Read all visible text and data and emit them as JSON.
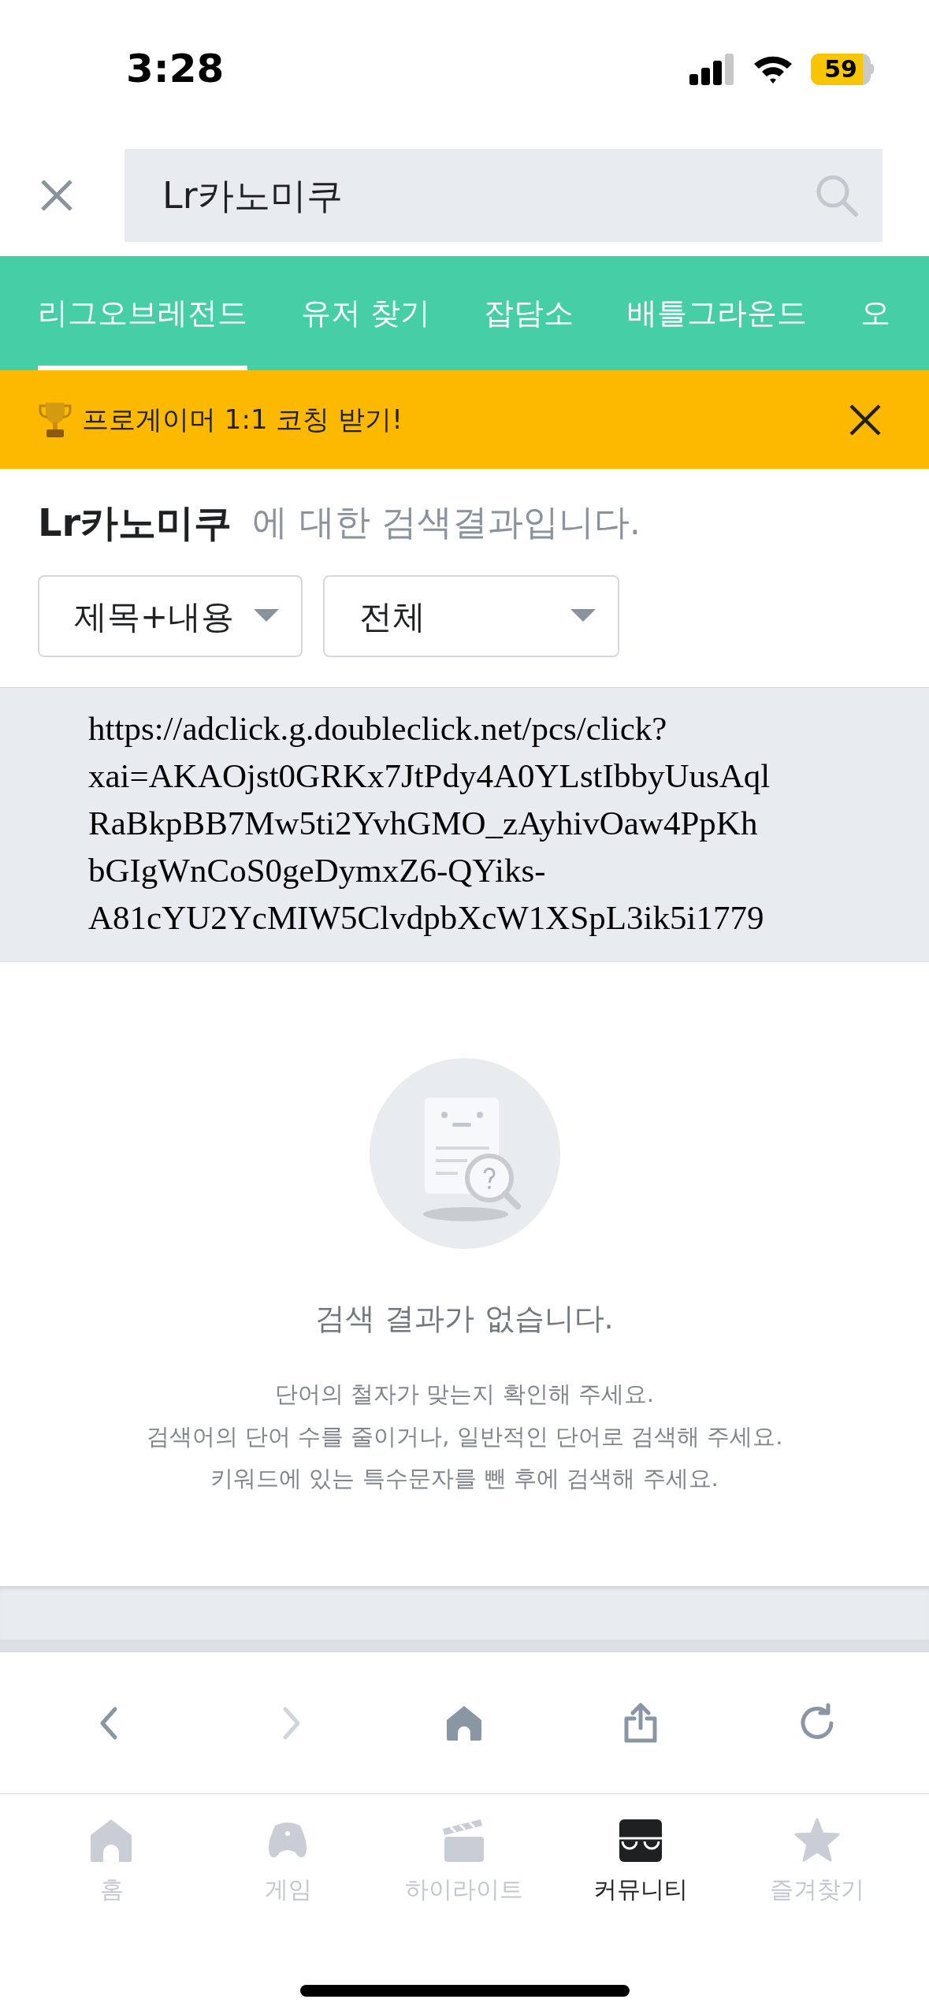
{
  "status_bar": {
    "time": "3:28",
    "battery": "59"
  },
  "search": {
    "value": "Lr카노미쿠"
  },
  "tabs": [
    {
      "label": "리그오브레전드",
      "selected": true
    },
    {
      "label": "유저 찾기",
      "selected": false
    },
    {
      "label": "잡담소",
      "selected": false
    },
    {
      "label": "배틀그라운드",
      "selected": false
    },
    {
      "label": "오",
      "selected": false
    }
  ],
  "banner": {
    "text": "프로게이머 1:1 코칭 받기!"
  },
  "result_heading": {
    "query": "Lr카노미쿠",
    "suffix": "에 대한 검색결과입니다."
  },
  "filters": [
    {
      "value": "제목+내용"
    },
    {
      "value": "전체"
    }
  ],
  "ad_url_lines": [
    "https://adclick.g.doubleclick.net/pcs/click?",
    "xai=AKAOjst0GRKx7JtPdy4A0YLstIbbyUusAql",
    "RaBkpBB7Mw5ti2YvhGMO_zAyhivOaw4PpKh",
    "bGIgWnCoS0geDymxZ6-QYiks-",
    "A81cYU2YcMIW5ClvdpbXcW1XSpL3ik5i1779"
  ],
  "empty_state": {
    "title": "검색 결과가 없습니다.",
    "tips": [
      "단어의 철자가 맞는지 확인해 주세요.",
      "검색어의 단어 수를 줄이거나, 일반적인 단어로 검색해 주세요.",
      "키워드에 있는 특수문자를 뺀 후에 검색해 주세요."
    ]
  },
  "browser_toolbar": [
    {
      "kind": "back",
      "disabled": false
    },
    {
      "kind": "forward",
      "disabled": true
    },
    {
      "kind": "home",
      "disabled": false
    },
    {
      "kind": "share",
      "disabled": false
    },
    {
      "kind": "reload",
      "disabled": false
    }
  ],
  "bottom_nav": [
    {
      "kind": "home",
      "label": "홈",
      "selected": false
    },
    {
      "kind": "game",
      "label": "게임",
      "selected": false
    },
    {
      "kind": "highlight",
      "label": "하이라이트",
      "selected": false
    },
    {
      "kind": "community",
      "label": "커뮤니티",
      "selected": true
    },
    {
      "kind": "favorites",
      "label": "즐겨찾기",
      "selected": false
    }
  ]
}
